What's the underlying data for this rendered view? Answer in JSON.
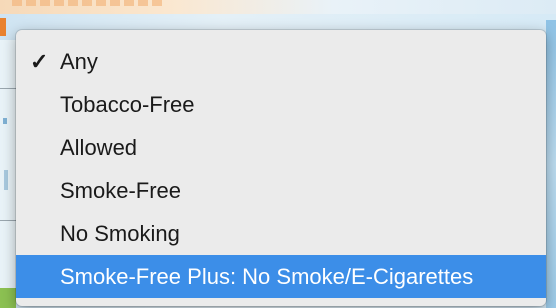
{
  "dropdown": {
    "checkmark": "✓",
    "items": [
      {
        "label": "Any",
        "checked": true,
        "highlighted": false
      },
      {
        "label": "Tobacco-Free",
        "checked": false,
        "highlighted": false
      },
      {
        "label": "Allowed",
        "checked": false,
        "highlighted": false
      },
      {
        "label": "Smoke-Free",
        "checked": false,
        "highlighted": false
      },
      {
        "label": "No Smoking",
        "checked": false,
        "highlighted": false
      },
      {
        "label": "Smoke-Free Plus: No Smoke/E-Cigarettes",
        "checked": false,
        "highlighted": true
      }
    ]
  },
  "colors": {
    "menu_background": "#ebebeb",
    "highlight": "#3c8ee8",
    "highlight_text": "#ffffff",
    "text": "#1a1a1a"
  }
}
